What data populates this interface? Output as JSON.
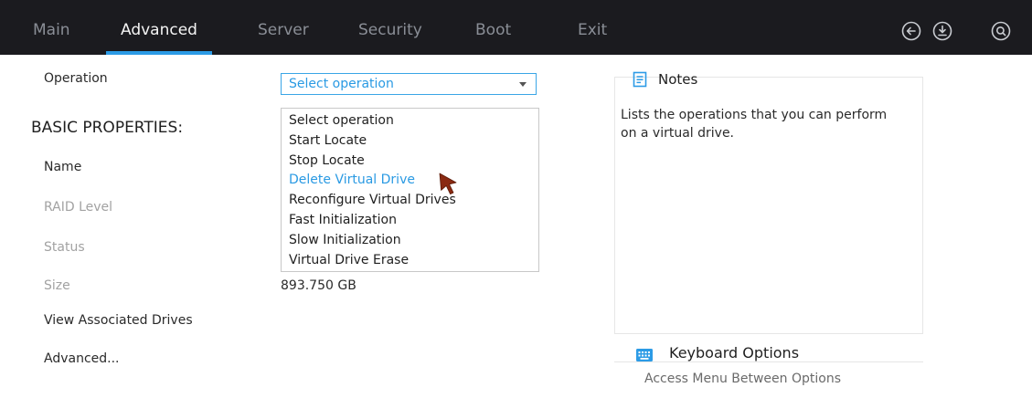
{
  "nav": {
    "tabs": [
      {
        "label": "Main",
        "active": false
      },
      {
        "label": "Advanced",
        "active": true
      },
      {
        "label": "Server",
        "active": false
      },
      {
        "label": "Security",
        "active": false
      },
      {
        "label": "Boot",
        "active": false
      },
      {
        "label": "Exit",
        "active": false
      }
    ],
    "icons": [
      "back-circle-icon",
      "save-circle-icon",
      "search-circle-icon"
    ]
  },
  "form": {
    "operation_label": "Operation",
    "operation_select": {
      "value": "Select operation",
      "options": [
        "Select operation",
        "Start Locate",
        "Stop Locate",
        "Delete Virtual Drive",
        "Reconfigure Virtual Drives",
        "Fast Initialization",
        "Slow Initialization",
        "Virtual Drive Erase"
      ],
      "hovered_option": "Delete Virtual Drive"
    },
    "section_title": "BASIC PROPERTIES:",
    "name_label": "Name",
    "raid_level_label": "RAID Level",
    "status_label": "Status",
    "size_label": "Size",
    "size_value": "893.750 GB",
    "view_drives_label": "View Associated Drives",
    "advanced_label": "Advanced..."
  },
  "notes": {
    "title": "Notes",
    "text": "Lists the operations that you can perform on a virtual drive."
  },
  "keyboard": {
    "title": "Keyboard Options",
    "subtext": "Access Menu Between Options"
  },
  "colors": {
    "topbar": "#1b1b1f",
    "accent": "#2c9be6",
    "link": "#2a9ae3",
    "muted": "#a2a2a2",
    "cursor": "#8a2a12"
  }
}
